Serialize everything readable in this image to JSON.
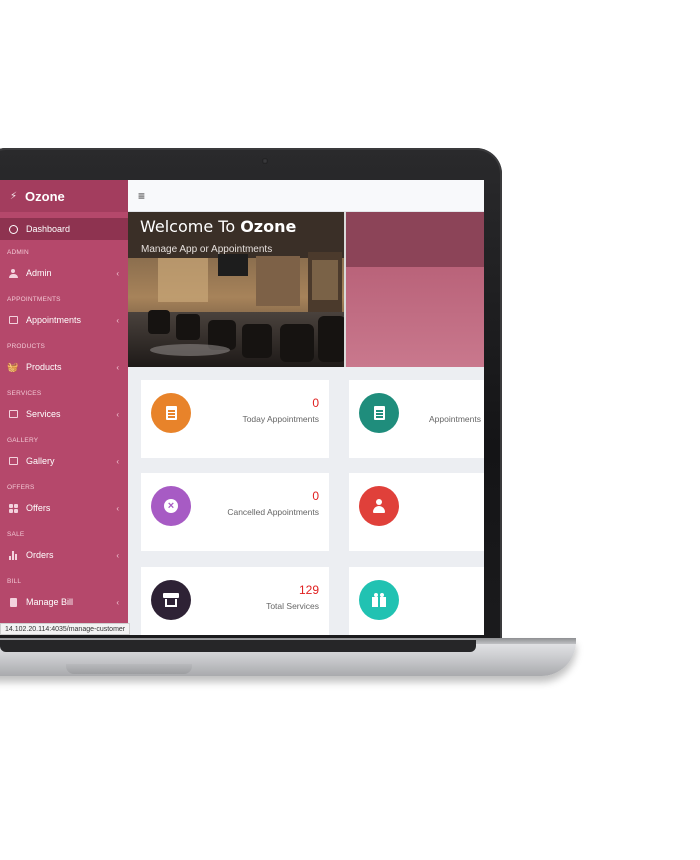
{
  "brand": {
    "name": "Ozone"
  },
  "sidebar": {
    "dashboard_label": "Dashboard",
    "sections": [
      {
        "header": "ADMIN",
        "label": "Admin",
        "icon": "user-icon"
      },
      {
        "header": "APPOINTMENTS",
        "label": "Appointments",
        "icon": "list-icon"
      },
      {
        "header": "PRODUCTS",
        "label": "Products",
        "icon": "basket-icon"
      },
      {
        "header": "SERVICES",
        "label": "Services",
        "icon": "card-icon"
      },
      {
        "header": "GALLERY",
        "label": "Gallery",
        "icon": "image-icon"
      },
      {
        "header": "OFFERS",
        "label": "Offers",
        "icon": "grid-icon"
      },
      {
        "header": "SALE",
        "label": "Orders",
        "icon": "bar-chart-icon"
      },
      {
        "header": "BILL",
        "label": "Manage Bill",
        "icon": "document-icon"
      }
    ]
  },
  "hero": {
    "title_prefix": "Welcome To ",
    "title_brand": "Ozone",
    "subtitle": "Manage App or Appointments"
  },
  "cards": [
    {
      "value": "0",
      "label": "Today Appointments",
      "color": "#e8832a",
      "icon": "document-icon"
    },
    {
      "value": "",
      "label": "Appointments",
      "color": "#1f8d7c",
      "icon": "document-icon"
    },
    {
      "value": "0",
      "label": "Cancelled Appointments",
      "color": "#a75bc4",
      "icon": "cancel-icon"
    },
    {
      "value": "",
      "label": "",
      "color": "#e0403a",
      "icon": "user-icon"
    },
    {
      "value": "129",
      "label": "Total Services",
      "color": "#2e2235",
      "icon": "store-icon"
    },
    {
      "value": "",
      "label": "",
      "color": "#21c2b2",
      "icon": "gift-icon"
    }
  ],
  "status_url": "14.102.20.114:4035/manage-customer"
}
